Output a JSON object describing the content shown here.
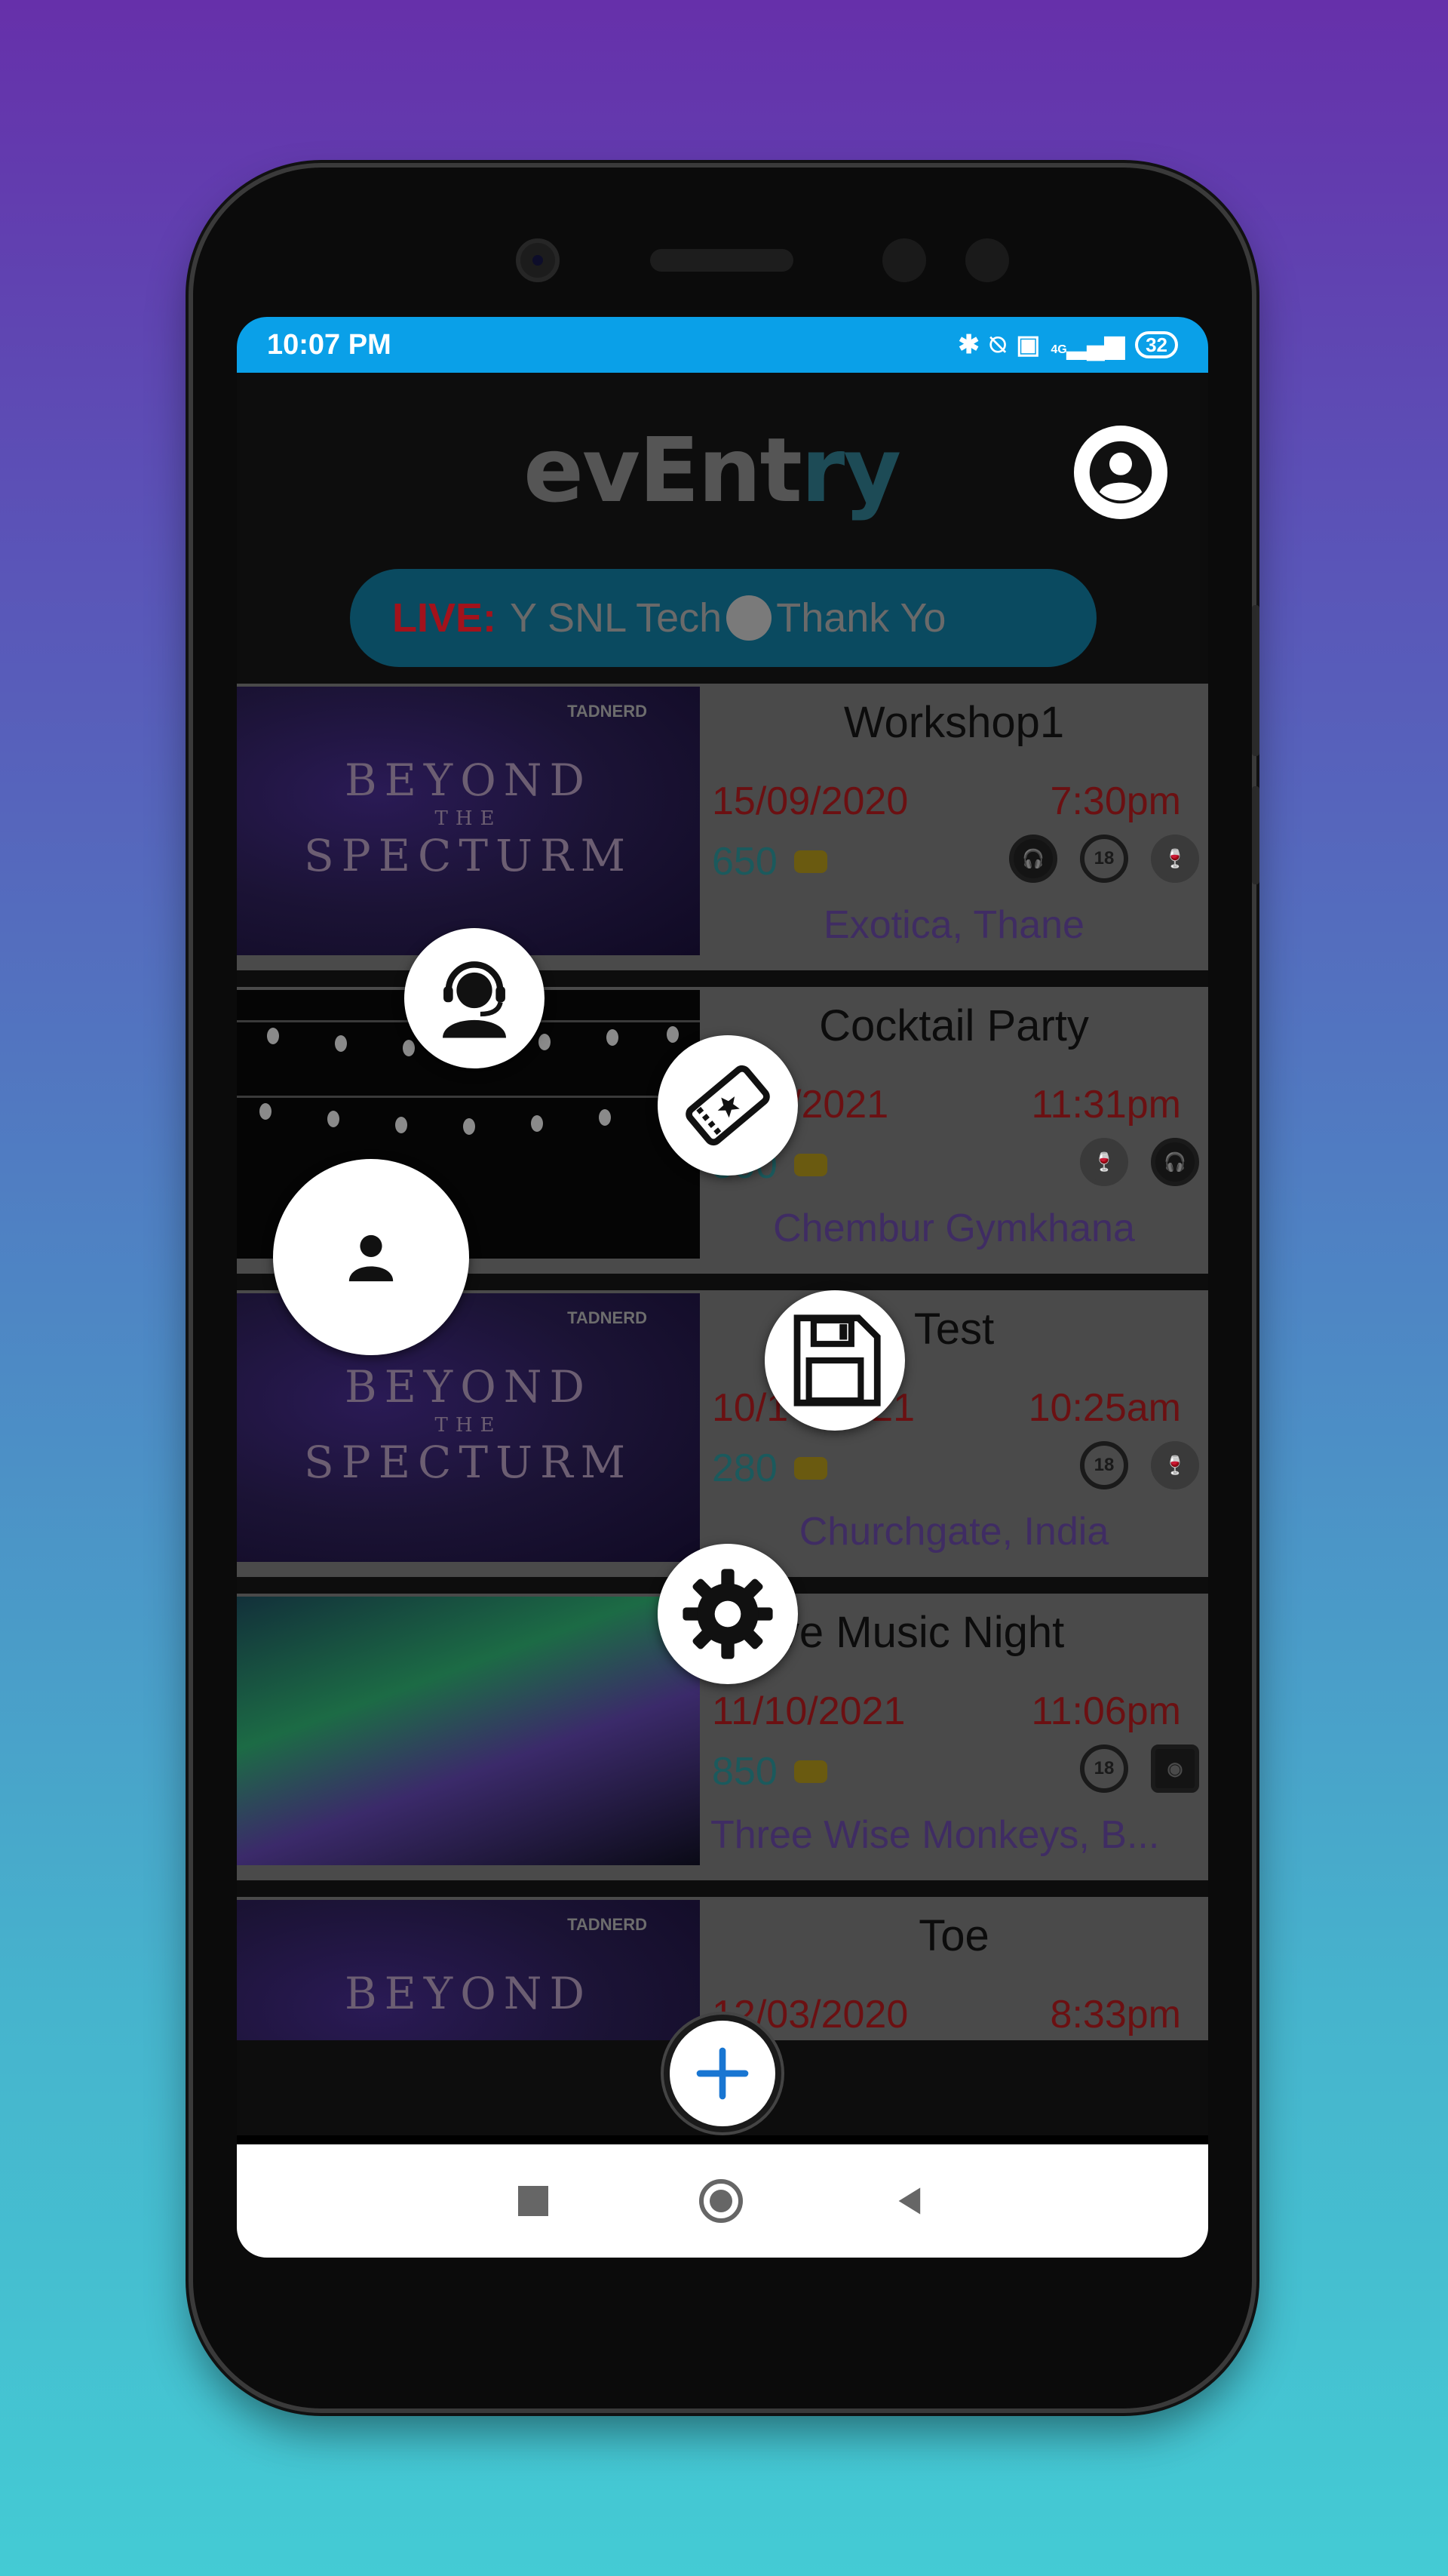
{
  "status_bar": {
    "time": "10:07 PM",
    "signal_label": "4G",
    "battery": "32"
  },
  "app": {
    "logo_part1": "evEnt",
    "logo_part2": "ry"
  },
  "ticker": {
    "live_label": "LIVE:",
    "text_before": "Y SNL Tech",
    "text_after": "Thank Yo"
  },
  "events": [
    {
      "title": "Workshop1",
      "date": "15/09/2020",
      "time": "7:30pm",
      "price": "650",
      "venue": "Exotica, Thane"
    },
    {
      "title": "Cocktail Party",
      "date": "/2021",
      "time": "11:31pm",
      "price": "500",
      "venue": "Chembur Gymkhana"
    },
    {
      "title": "Test",
      "date": "10/1",
      "date_end": "21",
      "time": "10:25am",
      "price": "280",
      "venue": "Churchgate, India"
    },
    {
      "title": "ive Music Night",
      "date": "11/10/2021",
      "time": "11:06pm",
      "price": "850",
      "venue": "Three Wise Monkeys, B..."
    },
    {
      "title": "Toe",
      "date": "12/03/2020",
      "time": "8:33pm"
    }
  ],
  "poster": {
    "line1": "BEYOND",
    "line2": "THE",
    "line3": "SPECTURM",
    "brand": "TADNERD"
  },
  "tag_18": "18",
  "menu_icons": [
    "support-agent-icon",
    "ticket-icon",
    "person-icon",
    "save-icon",
    "settings-icon",
    "add-icon"
  ]
}
